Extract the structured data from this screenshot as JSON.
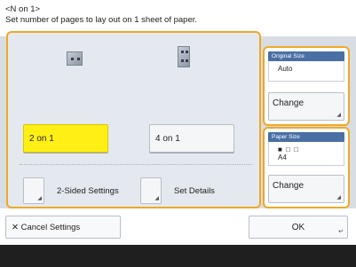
{
  "header": {
    "title": "<N on 1>",
    "instruction": "Set number of pages to lay out on 1 sheet of paper."
  },
  "layout_options": [
    {
      "label": "2 on 1",
      "selected": true
    },
    {
      "label": "4 on 1",
      "selected": false
    }
  ],
  "settings_buttons": {
    "two_sided": "2-Sided Settings",
    "set_details": "Set Details"
  },
  "original_size": {
    "header": "Original Size",
    "value": "Auto",
    "change_label": "Change"
  },
  "paper_size": {
    "header": "Paper Size",
    "icons": "■ □ □",
    "value": "A4",
    "change_label": "Change"
  },
  "footer_buttons": {
    "cancel": "Cancel Settings",
    "ok": "OK"
  },
  "colors": {
    "accent_border": "#f0a826",
    "selected_fill": "#ffef14",
    "card_header": "#4a6fa5"
  }
}
